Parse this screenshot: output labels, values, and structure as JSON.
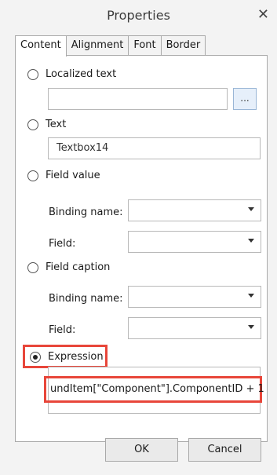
{
  "window": {
    "title": "Properties",
    "close_glyph": "✕"
  },
  "tabs": [
    {
      "label": "Content",
      "active": true
    },
    {
      "label": "Alignment",
      "active": false
    },
    {
      "label": "Font",
      "active": false
    },
    {
      "label": "Border",
      "active": false
    }
  ],
  "options": {
    "localized_text": {
      "label": "Localized text",
      "value": "",
      "browse_label": "..."
    },
    "text": {
      "label": "Text",
      "value": "Textbox14"
    },
    "field_value": {
      "label": "Field value",
      "binding_label": "Binding name:",
      "binding_value": "",
      "field_label": "Field:",
      "field_value": ""
    },
    "field_caption": {
      "label": "Field caption",
      "binding_label": "Binding name:",
      "binding_value": "",
      "field_label": "Field:",
      "field_value": ""
    },
    "expression": {
      "label": "Expression",
      "value": "undItem[\"Component\"].ComponentID + 1",
      "selected": true
    }
  },
  "buttons": {
    "ok": "OK",
    "cancel": "Cancel"
  },
  "colors": {
    "highlight": "#e8463a",
    "browse_bg": "#e6effa"
  }
}
